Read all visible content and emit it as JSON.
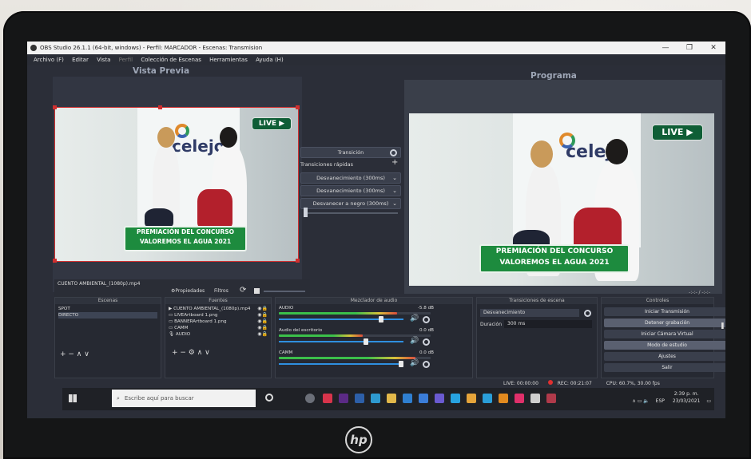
{
  "window": {
    "title": "OBS Studio 26.1.1 (64-bit, windows) - Perfil: MARCADOR - Escenas: Transmision",
    "min": "—",
    "max": "❐",
    "close": "✕"
  },
  "menu": [
    "Archivo (F)",
    "Editar",
    "Vista",
    "Perfil",
    "Colección de Escenas",
    "Herramientas",
    "Ayuda (H)"
  ],
  "labels": {
    "preview": "Vista Previa",
    "program": "Programa"
  },
  "video": {
    "live": "LIVE ▶",
    "banner_line1": "PREMIACIÓN DEL CONCURSO",
    "banner_line2": "VALOREMOS EL AGUA 2021",
    "logo": "celejo"
  },
  "transition_panel": {
    "transition_btn": "Transición",
    "quick": "Transiciones rápidas",
    "items": [
      "Desvanecimiento (300ms)",
      "Desvanecimiento (300ms)",
      "Desvanecer a negro (300ms)"
    ]
  },
  "source_bar": {
    "current": "CUENTO AMBIENTAL_(1080p).mp4",
    "properties": "⚙Propiedades",
    "filters": "Filtros"
  },
  "scenes": {
    "header": "Escenas",
    "items": [
      "SPOT",
      "DIRECTO"
    ],
    "selected": 1
  },
  "sources": {
    "header": "Fuentes",
    "items": [
      "CUENTO AMBIENTAL_(1080p).mp4",
      "LIVEArtboard 1.png",
      "BANNERArtboard 1.png",
      "CAMM",
      "AUDIO"
    ]
  },
  "mixer": {
    "header": "Mezclador de audio",
    "channels": [
      {
        "name": "AUDIO",
        "db": "-5.8 dB",
        "level": 0.78,
        "slider": 0.82
      },
      {
        "name": "Audio del escritorio",
        "db": "0.0 dB",
        "level": 0.55,
        "slider": 0.7
      },
      {
        "name": "CAMM",
        "db": "0.0 dB",
        "level": 0.9,
        "slider": 0.98
      }
    ]
  },
  "scene_transitions": {
    "header": "Transiciones de escena",
    "type": "Desvanecimiento",
    "duration_label": "Duración",
    "duration_value": "300 ms"
  },
  "controls": {
    "header": "Controles",
    "buttons": [
      "Iniciar Transmisión",
      "Detener grabación",
      "Iniciar Cámara Virtual",
      "Modo de estudio",
      "Ajustes",
      "Salir"
    ],
    "clock": "-:-:- / -:-:-"
  },
  "status": {
    "live": "LIVE: 00:00:00",
    "rec": "REC: 00:21:07",
    "cpu": "CPU: 60.7%, 30.00 fps"
  },
  "taskbar": {
    "search": "Escribe aquí para buscar",
    "lang": "ESP",
    "time": "2:39 p. m.",
    "date": "23/03/2021"
  },
  "brand": "hp",
  "colors": {
    "obs_bg": "#2b2e38",
    "preview_border": "#cf3030",
    "banner_green": "#1d8b3e",
    "rec_red": "#e03030"
  }
}
